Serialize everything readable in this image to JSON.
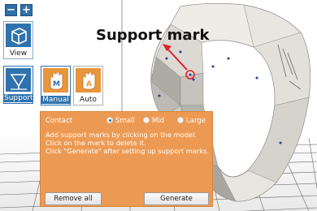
{
  "toolbar": {
    "minus_label": "−",
    "plus_label": "+",
    "view_label": "View",
    "support_label": "Support"
  },
  "modes": {
    "manual_label": "Manual",
    "auto_label": "Auto"
  },
  "annotation": {
    "title": "Support mark"
  },
  "panel": {
    "contact_label": "Contact",
    "options": [
      "Small",
      "Mid",
      "Large"
    ],
    "selected": "Small",
    "lines": [
      "Add support marks by clicking on the model.",
      "Click on the mark to delete it.",
      "Click \"Generate\" after setting up support marks."
    ],
    "remove_all_label": "Remove all",
    "generate_label": "Generate"
  },
  "colors": {
    "panel": "#ec9a53",
    "toolbar_blue": "#2f72ad",
    "mode_orange": "#e8963c",
    "arrow_red": "#e0202a"
  }
}
